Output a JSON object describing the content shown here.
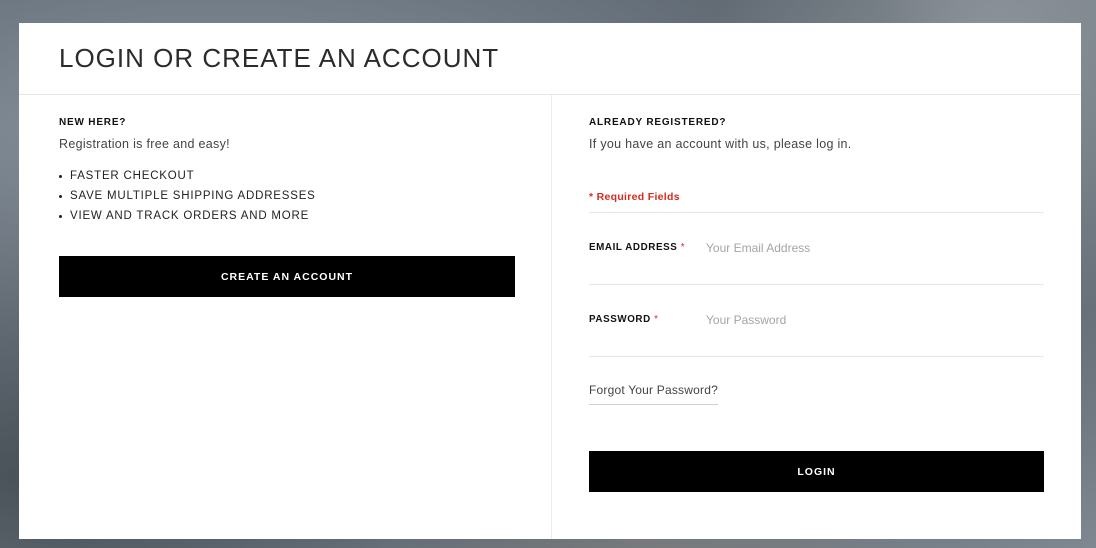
{
  "header": {
    "title": "LOGIN OR CREATE AN ACCOUNT"
  },
  "new_customer": {
    "heading": "NEW HERE?",
    "subtext": "Registration is free and easy!",
    "benefits": [
      "FASTER CHECKOUT",
      "SAVE MULTIPLE SHIPPING ADDRESSES",
      "VIEW AND TRACK ORDERS AND MORE"
    ],
    "create_button": "CREATE AN ACCOUNT"
  },
  "login": {
    "heading": "ALREADY REGISTERED?",
    "subtext": "If you have an account with us, please log in.",
    "required_note": "* Required Fields",
    "email": {
      "label": "EMAIL ADDRESS",
      "required_mark": "*",
      "placeholder": "Your Email Address",
      "value": ""
    },
    "password": {
      "label": "PASSWORD",
      "required_mark": "*",
      "placeholder": "Your Password",
      "value": ""
    },
    "forgot_link": "Forgot Your Password?",
    "login_button": "LOGIN"
  },
  "colors": {
    "button_bg": "#000000",
    "required": "#d52b1e"
  }
}
